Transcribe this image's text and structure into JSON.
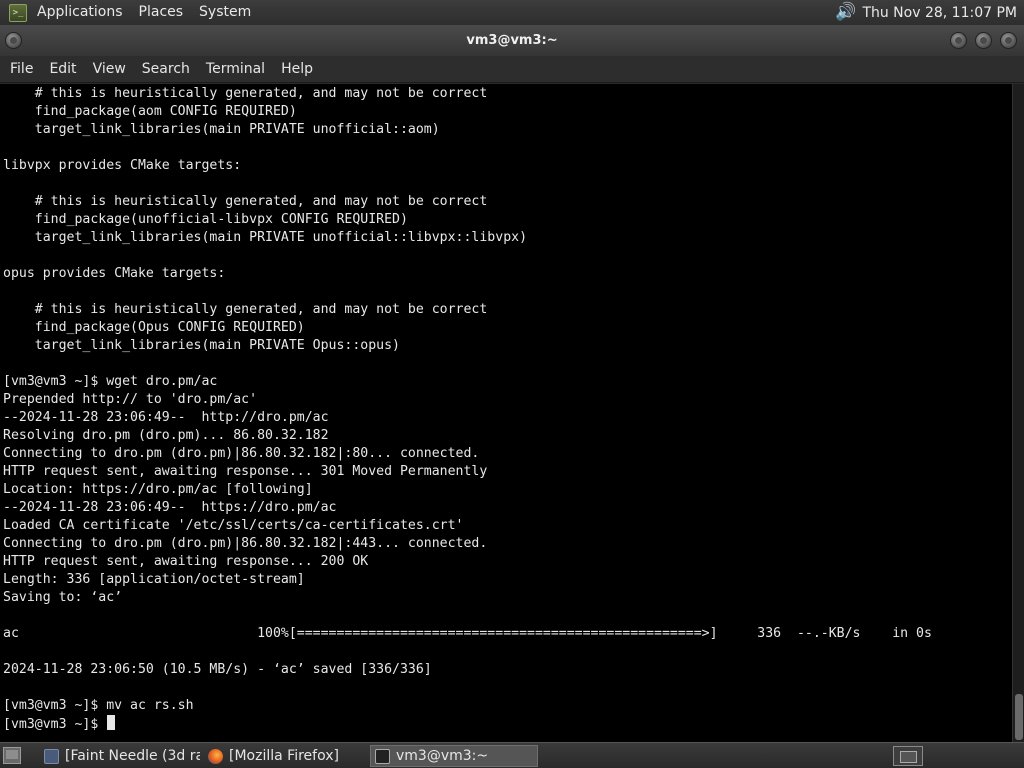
{
  "top_panel": {
    "menus": [
      "Applications",
      "Places",
      "System"
    ],
    "clock": "Thu Nov 28, 11:07 PM"
  },
  "window": {
    "title": "vm3@vm3:~"
  },
  "menubar": {
    "items": [
      "File",
      "Edit",
      "View",
      "Search",
      "Terminal",
      "Help"
    ]
  },
  "terminal": {
    "lines": [
      "    # this is heuristically generated, and may not be correct",
      "    find_package(aom CONFIG REQUIRED)",
      "    target_link_libraries(main PRIVATE unofficial::aom)",
      "",
      "libvpx provides CMake targets:",
      "",
      "    # this is heuristically generated, and may not be correct",
      "    find_package(unofficial-libvpx CONFIG REQUIRED)",
      "    target_link_libraries(main PRIVATE unofficial::libvpx::libvpx)",
      "",
      "opus provides CMake targets:",
      "",
      "    # this is heuristically generated, and may not be correct",
      "    find_package(Opus CONFIG REQUIRED)",
      "    target_link_libraries(main PRIVATE Opus::opus)",
      "",
      "[vm3@vm3 ~]$ wget dro.pm/ac",
      "Prepended http:// to 'dro.pm/ac'",
      "--2024-11-28 23:06:49--  http://dro.pm/ac",
      "Resolving dro.pm (dro.pm)... 86.80.32.182",
      "Connecting to dro.pm (dro.pm)|86.80.32.182|:80... connected.",
      "HTTP request sent, awaiting response... 301 Moved Permanently",
      "Location: https://dro.pm/ac [following]",
      "--2024-11-28 23:06:49--  https://dro.pm/ac",
      "Loaded CA certificate '/etc/ssl/certs/ca-certificates.crt'",
      "Connecting to dro.pm (dro.pm)|86.80.32.182|:443... connected.",
      "HTTP request sent, awaiting response... 200 OK",
      "Length: 336 [application/octet-stream]",
      "Saving to: ‘ac’",
      "",
      "ac                              100%[===================================================>]     336  --.-KB/s    in 0s",
      "",
      "2024-11-28 23:06:50 (10.5 MB/s) - ‘ac’ saved [336/336]",
      "",
      "[vm3@vm3 ~]$ mv ac rs.sh",
      "[vm3@vm3 ~]$ "
    ]
  },
  "taskbar": {
    "tasks": [
      {
        "label": "[Faint Needle (3d ra...",
        "icon": "app-window-icon",
        "active": false
      },
      {
        "label": "[Mozilla Firefox]",
        "icon": "firefox-icon",
        "active": false
      },
      {
        "label": "vm3@vm3:~",
        "icon": "terminal-icon",
        "active": true
      }
    ]
  }
}
